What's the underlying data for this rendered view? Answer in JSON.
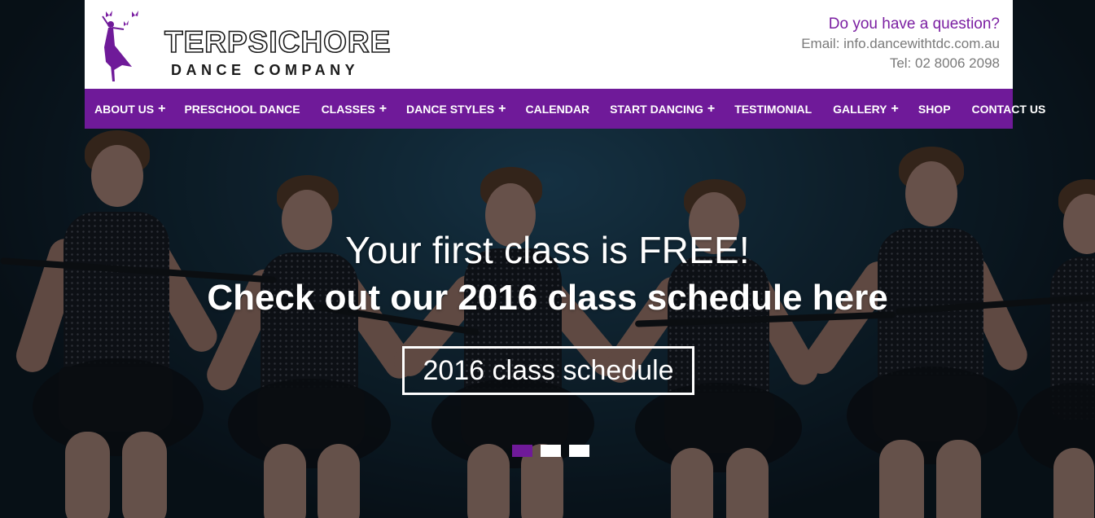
{
  "header": {
    "logo": {
      "title": "TERPSICHORE",
      "subtitle": "DANCE COMPANY"
    },
    "contact": {
      "question": "Do you have a question?",
      "email": "Email: info.dancewithtdc.com.au",
      "tel": "Tel: 02 8006 2098"
    }
  },
  "nav": {
    "items": [
      {
        "label": "ABOUT US",
        "plus": "+"
      },
      {
        "label": "PRESCHOOL DANCE",
        "plus": ""
      },
      {
        "label": "CLASSES",
        "plus": "+"
      },
      {
        "label": "DANCE STYLES",
        "plus": "+"
      },
      {
        "label": "CALENDAR",
        "plus": ""
      },
      {
        "label": "START DANCING",
        "plus": "+"
      },
      {
        "label": "TESTIMONIAL",
        "plus": ""
      },
      {
        "label": "GALLERY",
        "plus": "+"
      },
      {
        "label": "SHOP",
        "plus": ""
      },
      {
        "label": "CONTACT US",
        "plus": ""
      }
    ]
  },
  "hero": {
    "headline": "Your first class is FREE!",
    "subheadline": "Check out our 2016 class schedule here",
    "cta_label": "2016 class schedule",
    "slides": 3,
    "active_slide": 1
  },
  "colors": {
    "brand_purple": "#6f1a99",
    "question_purple": "#7b1fa2",
    "contact_gray": "#7a7a7a"
  }
}
